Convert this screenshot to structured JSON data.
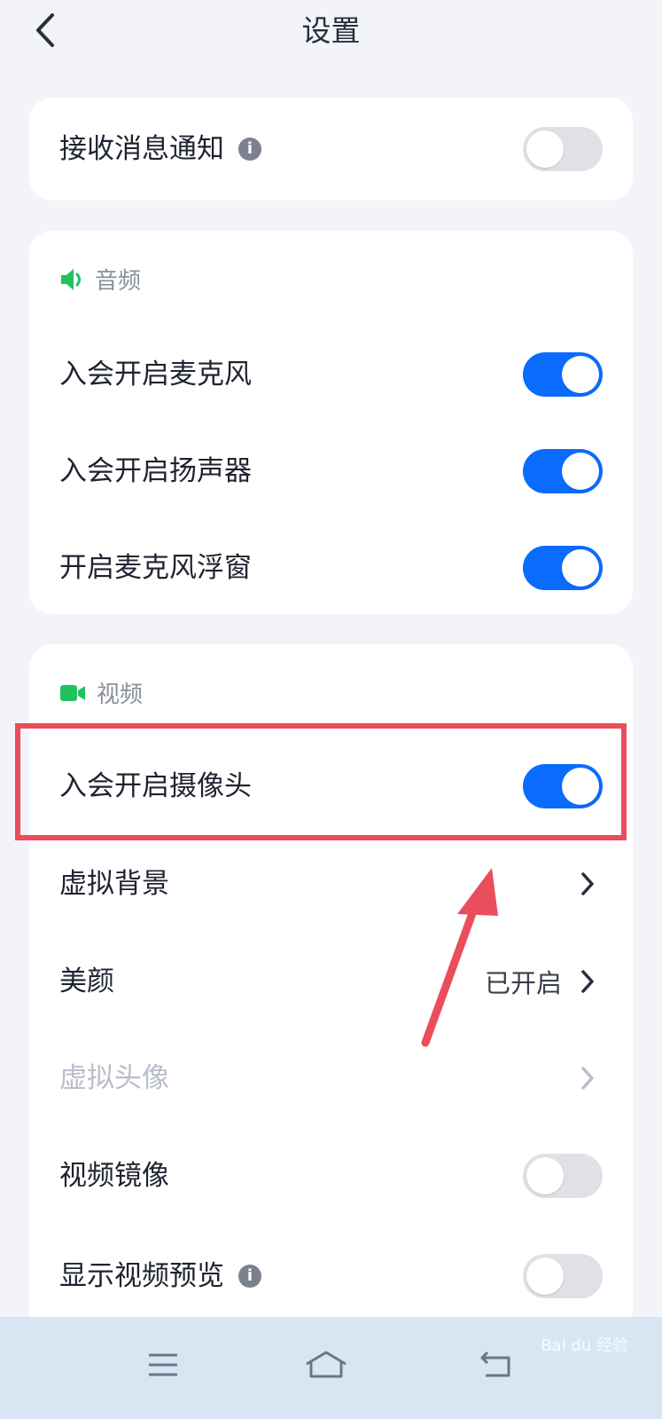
{
  "header": {
    "title": "设置"
  },
  "notifications": {
    "label": "接收消息通知",
    "enabled": false
  },
  "audio": {
    "section_title": "音频",
    "items": [
      {
        "label": "入会开启麦克风",
        "enabled": true
      },
      {
        "label": "入会开启扬声器",
        "enabled": true
      },
      {
        "label": "开启麦克风浮窗",
        "enabled": true
      }
    ]
  },
  "video": {
    "section_title": "视频",
    "camera": {
      "label": "入会开启摄像头",
      "enabled": true
    },
    "virtual_background": {
      "label": "虚拟背景"
    },
    "beauty": {
      "label": "美颜",
      "value": "已开启"
    },
    "virtual_avatar": {
      "label": "虚拟头像"
    },
    "mirror": {
      "label": "视频镜像",
      "enabled": false
    },
    "preview": {
      "label": "显示视频预览",
      "enabled": false
    }
  },
  "colors": {
    "accent": "#0a6cff",
    "section_icon": "#22c15e",
    "highlight": "#ea4d5c"
  },
  "watermark": "Bai du 经验"
}
